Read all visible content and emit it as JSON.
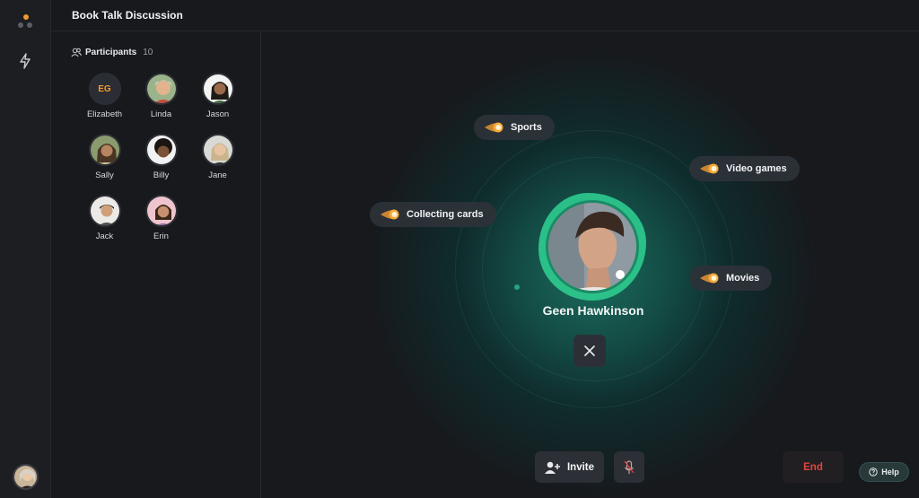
{
  "window": {
    "title": "Book Talk Discussion"
  },
  "rail": {
    "logo_icon": "three-dots-logo",
    "nav_icon": "lightning-bolt-icon"
  },
  "participants": {
    "label": "Participants",
    "count": "10",
    "people": [
      {
        "name": "Elizabeth",
        "initials": "EG"
      },
      {
        "name": "Linda"
      },
      {
        "name": "Jason"
      },
      {
        "name": "Sally"
      },
      {
        "name": "Billy"
      },
      {
        "name": "Jane"
      },
      {
        "name": "Jack"
      },
      {
        "name": "Erin"
      }
    ]
  },
  "stage": {
    "speaker_name": "Geen Hawkinson",
    "topics": [
      "Sports",
      "Video games",
      "Collecting cards",
      "Movies"
    ]
  },
  "controls": {
    "invite_label": "Invite",
    "end_label": "End",
    "help_label": "Help"
  },
  "colors": {
    "accent": "#f29a2e",
    "speaker_ring": "#2ecc8f",
    "end": "#e2433f"
  }
}
